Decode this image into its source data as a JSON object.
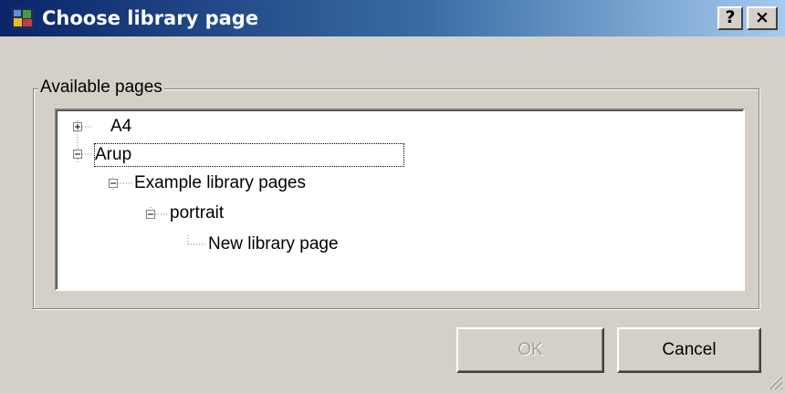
{
  "window": {
    "title": "Choose library page",
    "help_label": "?",
    "close_label": "×"
  },
  "group": {
    "label": "Available pages"
  },
  "tree": {
    "nodes": [
      {
        "label": "A4",
        "state": "collapsed",
        "depth": 0
      },
      {
        "label": "Arup",
        "state": "expanded",
        "depth": 0,
        "selected": true
      },
      {
        "label": "Example library pages",
        "state": "expanded",
        "depth": 1
      },
      {
        "label": "portrait",
        "state": "expanded",
        "depth": 2
      },
      {
        "label": "New library page",
        "state": "leaf",
        "depth": 3
      }
    ]
  },
  "buttons": {
    "ok_label": "OK",
    "ok_enabled": false,
    "cancel_label": "Cancel"
  },
  "icons": {
    "app": "app-icon",
    "help": "help-icon",
    "close": "close-icon",
    "expand": "plus-box-icon",
    "collapse": "minus-box-icon",
    "grip": "resize-grip-icon"
  },
  "colors": {
    "title_gradient_start": "#0a246a",
    "title_gradient_end": "#a6caf0",
    "face": "#d4d0c8",
    "tree_background": "#ffffff"
  }
}
